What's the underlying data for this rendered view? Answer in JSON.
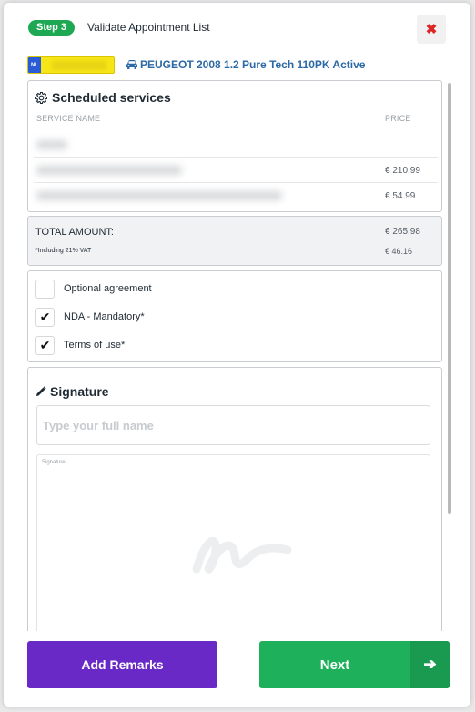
{
  "header": {
    "step_label": "Step 3",
    "title": "Validate Appointment List",
    "close_icon": "close-icon"
  },
  "vehicle": {
    "plate_country": "NL",
    "name": "PEUGEOT 2008 1.2 Pure Tech 110PK Active"
  },
  "services": {
    "title": "Scheduled services",
    "col_name": "SERVICE NAME",
    "col_price": "PRICE",
    "rows": [
      {
        "price": ""
      },
      {
        "price": "€ 210.99"
      },
      {
        "price": "€ 54.99"
      }
    ]
  },
  "totals": {
    "total_label": "TOTAL AMOUNT:",
    "total_value": "€ 265.98",
    "vat_label": "*Including 21% VAT",
    "vat_value": "€ 46.16"
  },
  "agreements": [
    {
      "label": "Optional agreement",
      "checked": false
    },
    {
      "label": "NDA - Mandatory*",
      "checked": true
    },
    {
      "label": "Terms of use*",
      "checked": true
    }
  ],
  "signature": {
    "title": "Signature",
    "name_placeholder": "Type your full name",
    "pad_label": "Signature"
  },
  "footer": {
    "remarks_label": "Add Remarks",
    "next_label": "Next"
  },
  "colors": {
    "accent_green": "#1fb05c",
    "accent_purple": "#6929c7",
    "link_blue": "#2b6aa6",
    "close_red": "#dc2626"
  }
}
